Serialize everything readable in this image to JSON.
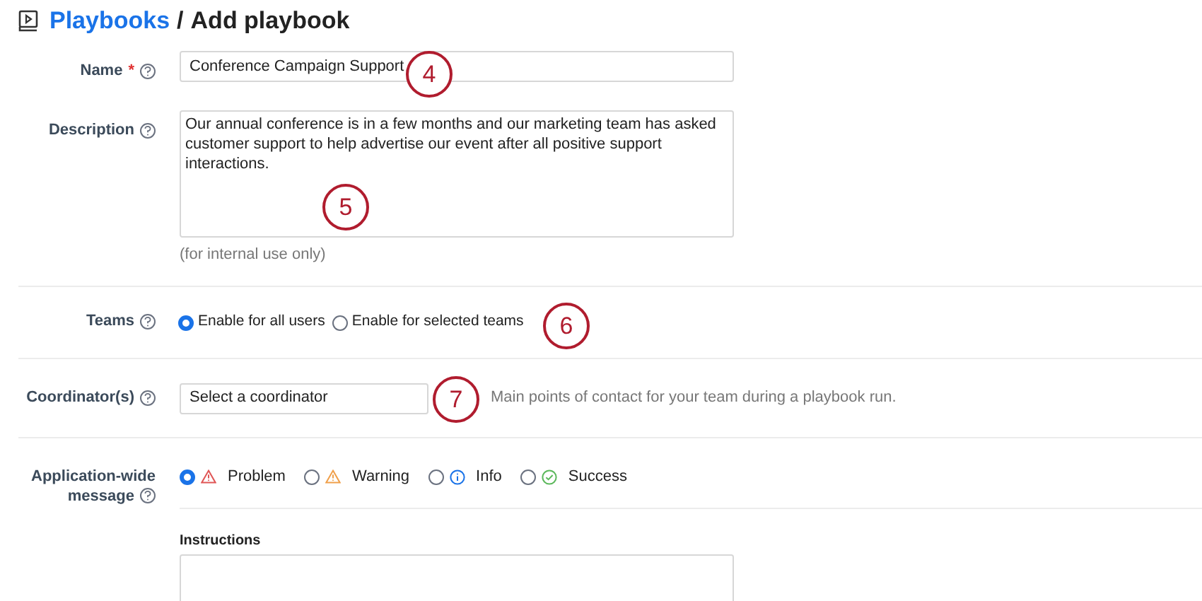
{
  "header": {
    "breadcrumb_link": "Playbooks",
    "separator": "/",
    "title": "Add playbook"
  },
  "name_field": {
    "label": "Name",
    "required_mark": "*",
    "value": "Conference Campaign Support"
  },
  "description_field": {
    "label": "Description",
    "value": "Our annual conference is in a few months and our marketing team has asked customer support to help advertise our event after all positive support interactions.",
    "hint": "(for internal use only)"
  },
  "teams": {
    "label": "Teams",
    "options": [
      {
        "label": "Enable for all users",
        "selected": true
      },
      {
        "label": "Enable for selected teams",
        "selected": false
      }
    ]
  },
  "coordinators": {
    "label": "Coordinator(s)",
    "placeholder": "Select a coordinator",
    "help": "Main points of contact for your team during a playbook run."
  },
  "message": {
    "label": "Application-wide message",
    "options": [
      {
        "kind": "problem",
        "label": "Problem",
        "selected": true
      },
      {
        "kind": "warning",
        "label": "Warning",
        "selected": false
      },
      {
        "kind": "info",
        "label": "Info",
        "selected": false
      },
      {
        "kind": "success",
        "label": "Success",
        "selected": false
      }
    ]
  },
  "instructions": {
    "label": "Instructions"
  },
  "callouts": [
    {
      "text": "4"
    },
    {
      "text": "5"
    },
    {
      "text": "6"
    },
    {
      "text": "7"
    }
  ]
}
